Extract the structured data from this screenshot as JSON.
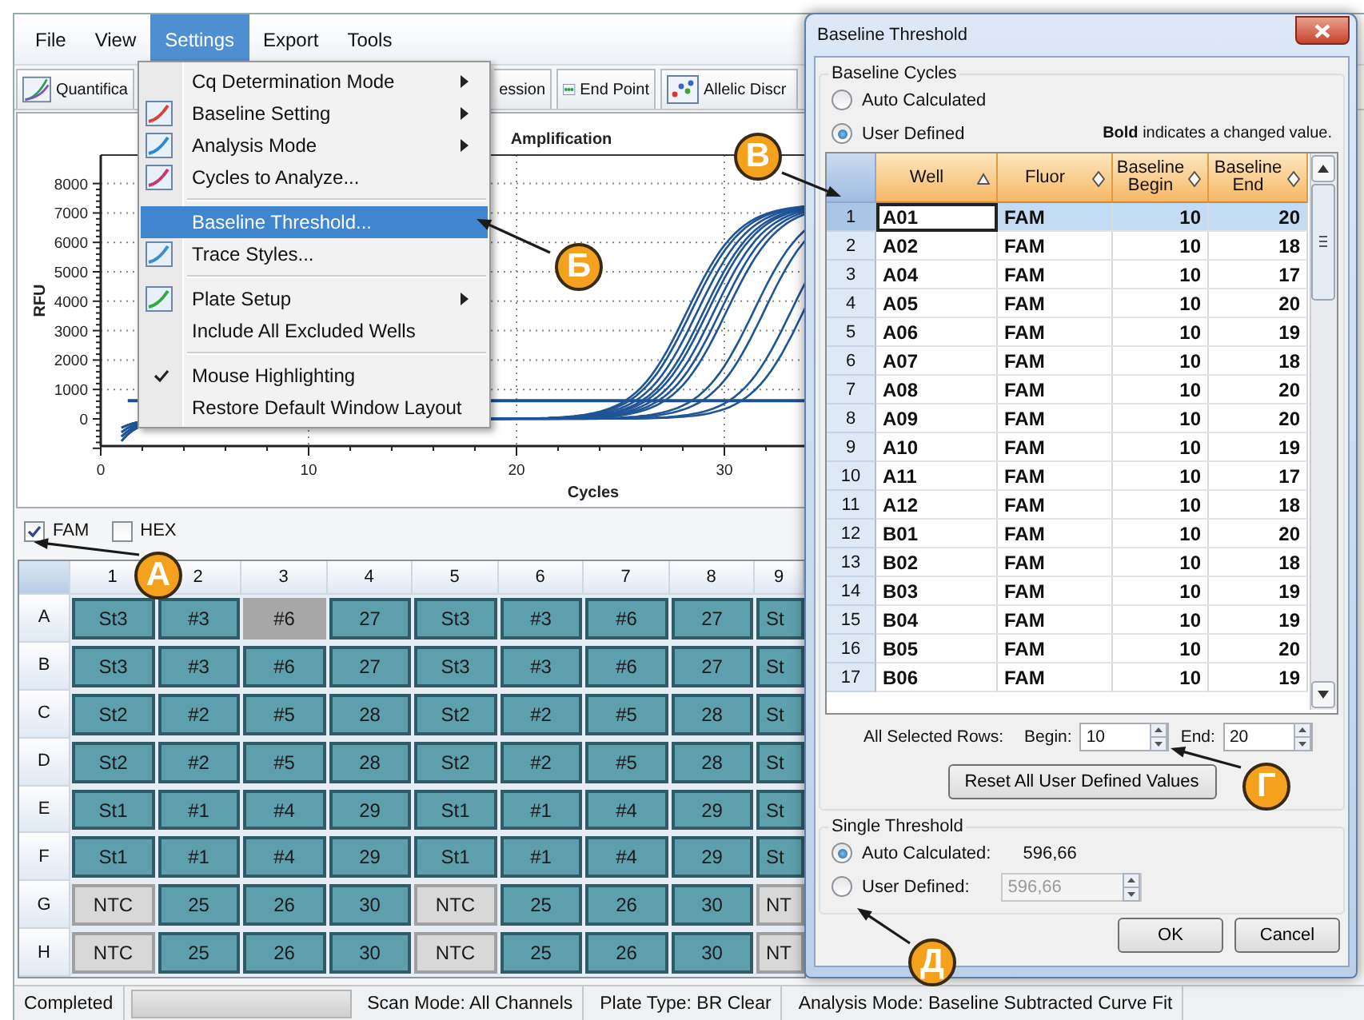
{
  "menubar": [
    {
      "label": "File",
      "selected": false
    },
    {
      "label": "View",
      "selected": false
    },
    {
      "label": "Settings",
      "selected": true
    },
    {
      "label": "Export",
      "selected": false
    },
    {
      "label": "Tools",
      "selected": false
    }
  ],
  "toolbar": [
    {
      "label": "Quantifica"
    },
    {
      "label": "ession"
    },
    {
      "label": "End Point"
    },
    {
      "label": "Allelic Discr"
    }
  ],
  "chart": {
    "title": "Amplification",
    "xlabel": "Cycles",
    "ylabel": "RFU",
    "xticks": [
      "0",
      "10",
      "20",
      "30"
    ],
    "yticks": [
      "8000",
      "7000",
      "6000",
      "5000",
      "4000",
      "3000",
      "2000",
      "1000",
      "0"
    ]
  },
  "fluors": [
    {
      "label": "FAM",
      "checked": true
    },
    {
      "label": "HEX",
      "checked": false
    }
  ],
  "plate": {
    "columns": [
      "1",
      "2",
      "3",
      "4",
      "5",
      "6",
      "7",
      "8",
      "9"
    ],
    "rows": [
      {
        "label": "A",
        "cells": [
          {
            "text": "St3",
            "kind": "sample",
            "selected": false
          },
          {
            "text": "#3",
            "kind": "sample",
            "selected": false
          },
          {
            "text": "#6",
            "kind": "sample",
            "selected": true
          },
          {
            "text": "27",
            "kind": "sample",
            "selected": false
          },
          {
            "text": "St3",
            "kind": "sample",
            "selected": false
          },
          {
            "text": "#3",
            "kind": "sample",
            "selected": false
          },
          {
            "text": "#6",
            "kind": "sample",
            "selected": false
          },
          {
            "text": "27",
            "kind": "sample",
            "selected": false
          },
          {
            "text": "St",
            "kind": "sample",
            "selected": false
          }
        ]
      },
      {
        "label": "B",
        "cells": [
          {
            "text": "St3",
            "kind": "sample",
            "selected": false
          },
          {
            "text": "#3",
            "kind": "sample",
            "selected": false
          },
          {
            "text": "#6",
            "kind": "sample",
            "selected": false
          },
          {
            "text": "27",
            "kind": "sample",
            "selected": false
          },
          {
            "text": "St3",
            "kind": "sample",
            "selected": false
          },
          {
            "text": "#3",
            "kind": "sample",
            "selected": false
          },
          {
            "text": "#6",
            "kind": "sample",
            "selected": false
          },
          {
            "text": "27",
            "kind": "sample",
            "selected": false
          },
          {
            "text": "St",
            "kind": "sample",
            "selected": false
          }
        ]
      },
      {
        "label": "C",
        "cells": [
          {
            "text": "St2",
            "kind": "sample",
            "selected": false
          },
          {
            "text": "#2",
            "kind": "sample",
            "selected": false
          },
          {
            "text": "#5",
            "kind": "sample",
            "selected": false
          },
          {
            "text": "28",
            "kind": "sample",
            "selected": false
          },
          {
            "text": "St2",
            "kind": "sample",
            "selected": false
          },
          {
            "text": "#2",
            "kind": "sample",
            "selected": false
          },
          {
            "text": "#5",
            "kind": "sample",
            "selected": false
          },
          {
            "text": "28",
            "kind": "sample",
            "selected": false
          },
          {
            "text": "St",
            "kind": "sample",
            "selected": false
          }
        ]
      },
      {
        "label": "D",
        "cells": [
          {
            "text": "St2",
            "kind": "sample",
            "selected": false
          },
          {
            "text": "#2",
            "kind": "sample",
            "selected": false
          },
          {
            "text": "#5",
            "kind": "sample",
            "selected": false
          },
          {
            "text": "28",
            "kind": "sample",
            "selected": false
          },
          {
            "text": "St2",
            "kind": "sample",
            "selected": false
          },
          {
            "text": "#2",
            "kind": "sample",
            "selected": false
          },
          {
            "text": "#5",
            "kind": "sample",
            "selected": false
          },
          {
            "text": "28",
            "kind": "sample",
            "selected": false
          },
          {
            "text": "St",
            "kind": "sample",
            "selected": false
          }
        ]
      },
      {
        "label": "E",
        "cells": [
          {
            "text": "St1",
            "kind": "sample",
            "selected": false
          },
          {
            "text": "#1",
            "kind": "sample",
            "selected": false
          },
          {
            "text": "#4",
            "kind": "sample",
            "selected": false
          },
          {
            "text": "29",
            "kind": "sample",
            "selected": false
          },
          {
            "text": "St1",
            "kind": "sample",
            "selected": false
          },
          {
            "text": "#1",
            "kind": "sample",
            "selected": false
          },
          {
            "text": "#4",
            "kind": "sample",
            "selected": false
          },
          {
            "text": "29",
            "kind": "sample",
            "selected": false
          },
          {
            "text": "St",
            "kind": "sample",
            "selected": false
          }
        ]
      },
      {
        "label": "F",
        "cells": [
          {
            "text": "St1",
            "kind": "sample",
            "selected": false
          },
          {
            "text": "#1",
            "kind": "sample",
            "selected": false
          },
          {
            "text": "#4",
            "kind": "sample",
            "selected": false
          },
          {
            "text": "29",
            "kind": "sample",
            "selected": false
          },
          {
            "text": "St1",
            "kind": "sample",
            "selected": false
          },
          {
            "text": "#1",
            "kind": "sample",
            "selected": false
          },
          {
            "text": "#4",
            "kind": "sample",
            "selected": false
          },
          {
            "text": "29",
            "kind": "sample",
            "selected": false
          },
          {
            "text": "St",
            "kind": "sample",
            "selected": false
          }
        ]
      },
      {
        "label": "G",
        "cells": [
          {
            "text": "NTC",
            "kind": "ntc",
            "selected": false
          },
          {
            "text": "25",
            "kind": "sample",
            "selected": false
          },
          {
            "text": "26",
            "kind": "sample",
            "selected": false
          },
          {
            "text": "30",
            "kind": "sample",
            "selected": false
          },
          {
            "text": "NTC",
            "kind": "ntc",
            "selected": false
          },
          {
            "text": "25",
            "kind": "sample",
            "selected": false
          },
          {
            "text": "26",
            "kind": "sample",
            "selected": false
          },
          {
            "text": "30",
            "kind": "sample",
            "selected": false
          },
          {
            "text": "NT",
            "kind": "ntc",
            "selected": false
          }
        ]
      },
      {
        "label": "H",
        "cells": [
          {
            "text": "NTC",
            "kind": "ntc",
            "selected": false
          },
          {
            "text": "25",
            "kind": "sample",
            "selected": false
          },
          {
            "text": "26",
            "kind": "sample",
            "selected": false
          },
          {
            "text": "30",
            "kind": "sample",
            "selected": false
          },
          {
            "text": "NTC",
            "kind": "ntc",
            "selected": false
          },
          {
            "text": "25",
            "kind": "sample",
            "selected": false
          },
          {
            "text": "26",
            "kind": "sample",
            "selected": false
          },
          {
            "text": "30",
            "kind": "sample",
            "selected": false
          },
          {
            "text": "NT",
            "kind": "ntc",
            "selected": false
          }
        ]
      }
    ]
  },
  "status_bar": {
    "status": "Completed",
    "progress": {
      "level": 0
    },
    "items": [
      "Scan Mode: All Channels",
      "Plate Type: BR Clear",
      "Analysis Mode: Baseline Subtracted Curve Fit"
    ]
  },
  "settings_menu": {
    "groups": [
      [
        {
          "label": "Cq Determination Mode",
          "has_icon": false,
          "submenu": true,
          "checked": false,
          "selected": false
        },
        {
          "label": "Baseline Setting",
          "has_icon": true,
          "submenu": true,
          "checked": false,
          "selected": false
        },
        {
          "label": "Analysis Mode",
          "has_icon": true,
          "submenu": true,
          "checked": false,
          "selected": false
        },
        {
          "label": "Cycles to Analyze...",
          "has_icon": true,
          "submenu": false,
          "checked": false,
          "selected": false
        }
      ],
      [
        {
          "label": "Baseline Threshold...",
          "has_icon": false,
          "submenu": false,
          "checked": false,
          "selected": true
        },
        {
          "label": "Trace Styles...",
          "has_icon": true,
          "submenu": false,
          "checked": false,
          "selected": false
        }
      ],
      [
        {
          "label": "Plate Setup",
          "has_icon": true,
          "submenu": true,
          "checked": false,
          "selected": false
        },
        {
          "label": "Include All Excluded Wells",
          "has_icon": false,
          "submenu": false,
          "checked": false,
          "selected": false
        }
      ],
      [
        {
          "label": "Mouse Highlighting",
          "has_icon": false,
          "submenu": false,
          "checked": true,
          "selected": false
        },
        {
          "label": "Restore Default Window Layout",
          "has_icon": false,
          "submenu": false,
          "checked": false,
          "selected": false
        }
      ]
    ]
  },
  "dialog": {
    "title": "Baseline Threshold",
    "baseline_cycles": {
      "title": "Baseline Cycles",
      "options": [
        {
          "label": "Auto Calculated",
          "selected": false
        },
        {
          "label": "User Defined",
          "selected": true
        }
      ],
      "note": "**Bold** indicates a changed value.",
      "columns": [
        {
          "label": "Well",
          "sorted": true
        },
        {
          "label": "Fluor",
          "sorted": false
        },
        {
          "label": "Baseline Begin",
          "sorted": false
        },
        {
          "label": "Baseline End",
          "sorted": false
        }
      ],
      "rows": [
        {
          "number": "1",
          "well": "A01",
          "fluor": "FAM",
          "begin": "10",
          "end": "20",
          "changed": true,
          "selected": true
        },
        {
          "number": "2",
          "well": "A02",
          "fluor": "FAM",
          "begin": "10",
          "end": "18",
          "changed": true,
          "selected": false
        },
        {
          "number": "3",
          "well": "A04",
          "fluor": "FAM",
          "begin": "10",
          "end": "17",
          "changed": true,
          "selected": false
        },
        {
          "number": "4",
          "well": "A05",
          "fluor": "FAM",
          "begin": "10",
          "end": "20",
          "changed": true,
          "selected": false
        },
        {
          "number": "5",
          "well": "A06",
          "fluor": "FAM",
          "begin": "10",
          "end": "19",
          "changed": true,
          "selected": false
        },
        {
          "number": "6",
          "well": "A07",
          "fluor": "FAM",
          "begin": "10",
          "end": "18",
          "changed": true,
          "selected": false
        },
        {
          "number": "7",
          "well": "A08",
          "fluor": "FAM",
          "begin": "10",
          "end": "20",
          "changed": true,
          "selected": false
        },
        {
          "number": "8",
          "well": "A09",
          "fluor": "FAM",
          "begin": "10",
          "end": "20",
          "changed": true,
          "selected": false
        },
        {
          "number": "9",
          "well": "A10",
          "fluor": "FAM",
          "begin": "10",
          "end": "19",
          "changed": true,
          "selected": false
        },
        {
          "number": "10",
          "well": "A11",
          "fluor": "FAM",
          "begin": "10",
          "end": "17",
          "changed": true,
          "selected": false
        },
        {
          "number": "11",
          "well": "A12",
          "fluor": "FAM",
          "begin": "10",
          "end": "18",
          "changed": true,
          "selected": false
        },
        {
          "number": "12",
          "well": "B01",
          "fluor": "FAM",
          "begin": "10",
          "end": "20",
          "changed": true,
          "selected": false
        },
        {
          "number": "13",
          "well": "B02",
          "fluor": "FAM",
          "begin": "10",
          "end": "18",
          "changed": true,
          "selected": false
        },
        {
          "number": "14",
          "well": "B03",
          "fluor": "FAM",
          "begin": "10",
          "end": "19",
          "changed": true,
          "selected": false
        },
        {
          "number": "15",
          "well": "B04",
          "fluor": "FAM",
          "begin": "10",
          "end": "19",
          "changed": true,
          "selected": false
        },
        {
          "number": "16",
          "well": "B05",
          "fluor": "FAM",
          "begin": "10",
          "end": "20",
          "changed": true,
          "selected": false
        },
        {
          "number": "17",
          "well": "B06",
          "fluor": "FAM",
          "begin": "10",
          "end": "19",
          "changed": true,
          "selected": false
        }
      ],
      "selected_rows_label": "All Selected Rows:",
      "begin": {
        "label": "Begin:",
        "value": "10"
      },
      "end": {
        "label": "End:",
        "value": "20"
      },
      "reset_button": "Reset All User Defined Values"
    },
    "single_threshold": {
      "title": "Single Threshold",
      "options": [
        {
          "label": "Auto Calculated:",
          "selected": true,
          "value": "596,66"
        },
        {
          "label": "User Defined:",
          "selected": false,
          "field": "596,66",
          "disabled": true
        }
      ]
    },
    "buttons": [
      "OK",
      "Cancel"
    ]
  },
  "callouts": [
    {
      "label": "В"
    },
    {
      "label": "Б"
    },
    {
      "label": "А"
    },
    {
      "label": "Г"
    },
    {
      "label": "Д"
    }
  ]
}
